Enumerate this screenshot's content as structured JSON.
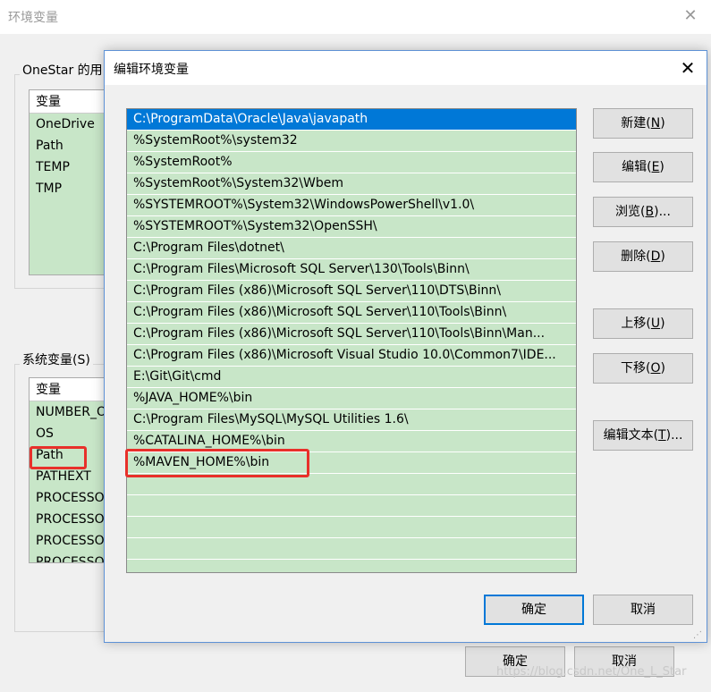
{
  "background_window": {
    "title": "环境变量",
    "user_group_label": "OneStar 的用",
    "user_list": {
      "column_header": "变量",
      "rows": [
        "OneDrive",
        "Path",
        "TEMP",
        "TMP"
      ]
    },
    "system_group_label": "系统变量(S)",
    "system_list": {
      "column_header": "变量",
      "rows": [
        "NUMBER_OF_PROCESSORS",
        "OS",
        "Path",
        "PATHEXT",
        "PROCESSOR_ARCHITECTURE",
        "PROCESSOR_IDENTIFIER",
        "PROCESSOR_LEVEL",
        "PROCESSOR_REVISION"
      ]
    },
    "ok_label": "确定",
    "cancel_label": "取消"
  },
  "dialog": {
    "title": "编辑环境变量",
    "paths": [
      "C:\\ProgramData\\Oracle\\Java\\javapath",
      "%SystemRoot%\\system32",
      "%SystemRoot%",
      "%SystemRoot%\\System32\\Wbem",
      "%SYSTEMROOT%\\System32\\WindowsPowerShell\\v1.0\\",
      "%SYSTEMROOT%\\System32\\OpenSSH\\",
      "C:\\Program Files\\dotnet\\",
      "C:\\Program Files\\Microsoft SQL Server\\130\\Tools\\Binn\\",
      "C:\\Program Files (x86)\\Microsoft SQL Server\\110\\DTS\\Binn\\",
      "C:\\Program Files (x86)\\Microsoft SQL Server\\110\\Tools\\Binn\\",
      "C:\\Program Files (x86)\\Microsoft SQL Server\\110\\Tools\\Binn\\Man...",
      "C:\\Program Files (x86)\\Microsoft Visual Studio 10.0\\Common7\\IDE...",
      "E:\\Git\\Git\\cmd",
      "%JAVA_HOME%\\bin",
      "C:\\Program Files\\MySQL\\MySQL Utilities 1.6\\",
      "%CATALINA_HOME%\\bin",
      "%MAVEN_HOME%\\bin"
    ],
    "selected_index": 0,
    "buttons": {
      "new": {
        "label": "新建(",
        "key": "N",
        "end": ")"
      },
      "edit": {
        "label": "编辑(",
        "key": "E",
        "end": ")"
      },
      "browse": {
        "label": "浏览(",
        "key": "B",
        "end": ")..."
      },
      "delete": {
        "label": "删除(",
        "key": "D",
        "end": ")"
      },
      "move_up": {
        "label": "上移(",
        "key": "U",
        "end": ")"
      },
      "move_down": {
        "label": "下移(",
        "key": "O",
        "end": ")"
      },
      "edit_text": {
        "label": "编辑文本(",
        "key": "T",
        "end": ")..."
      }
    },
    "ok_label": "确定",
    "cancel_label": "取消"
  },
  "highlight_color": "#e8302a",
  "selection_color": "#0078d7",
  "list_background": "#c8e6c8",
  "watermark": "https://blog.csdn.net/One_L_Star"
}
